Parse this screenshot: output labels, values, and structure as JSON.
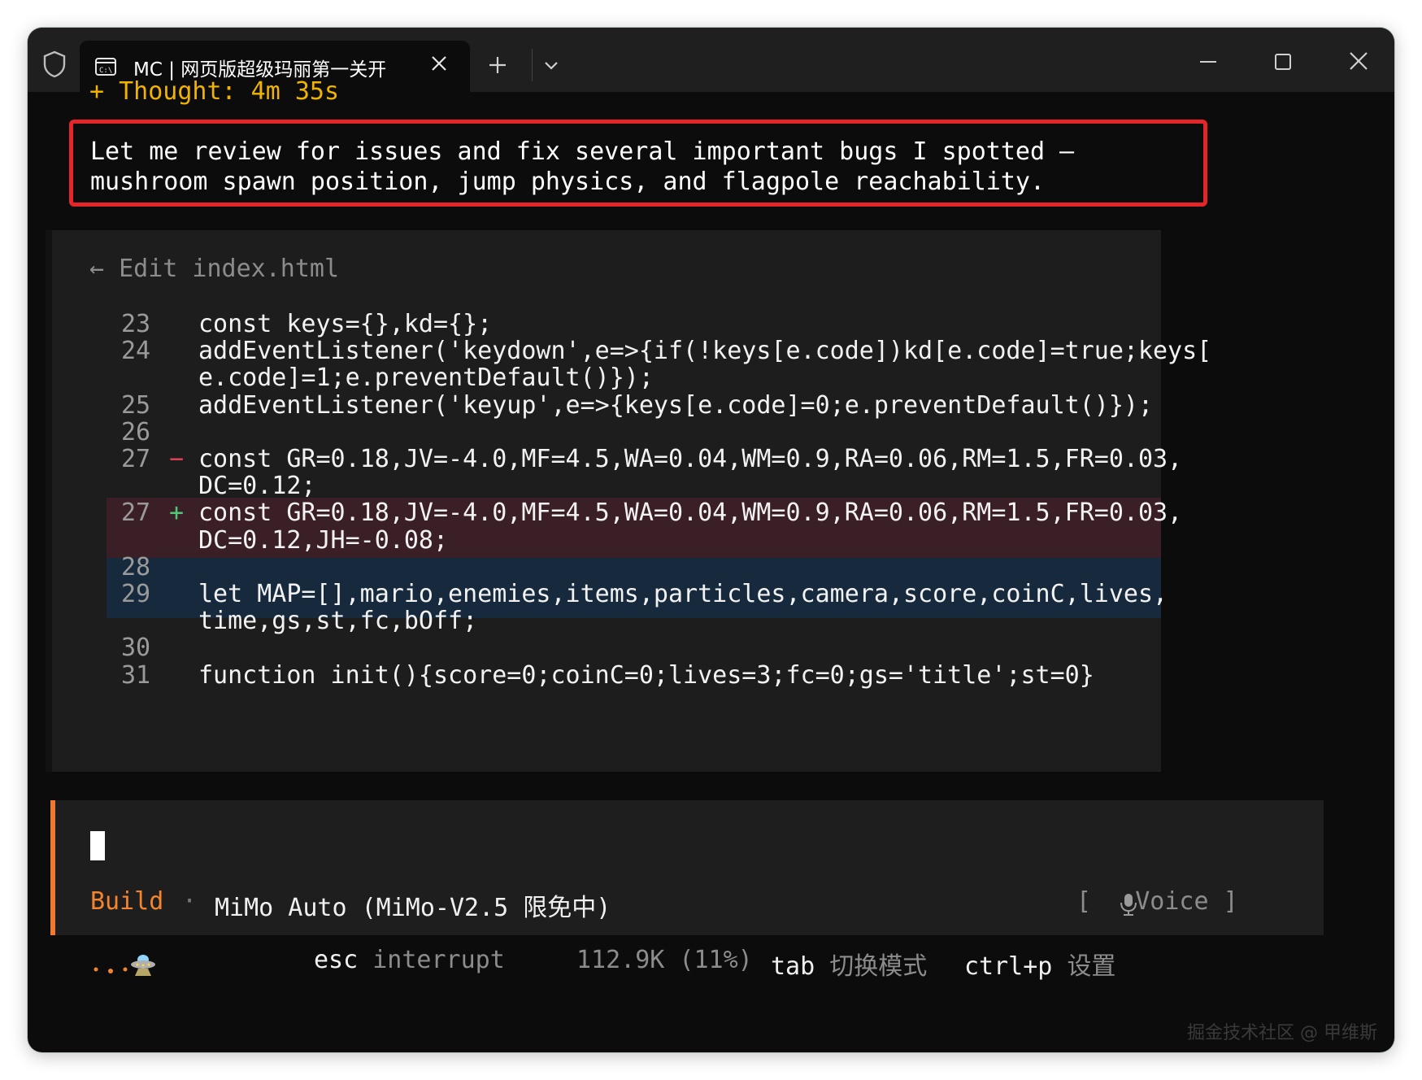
{
  "tab": {
    "title": "MC | 网页版超级玛丽第一关开"
  },
  "thought": "+ Thought: 4m 35s",
  "message": {
    "line1": "Let me review for issues and fix several important bugs I spotted –",
    "line2": "mushroom spawn position, jump physics, and flagpole reachability."
  },
  "edit": {
    "header": "← Edit index.html",
    "lines": [
      {
        "num": "23",
        "sign": "",
        "text": "const keys={},kd={};"
      },
      {
        "num": "24",
        "sign": "",
        "text": "addEventListener('keydown',e=>{if(!keys[e.code])kd[e.code]=true;keys["
      },
      {
        "num": "",
        "sign": "",
        "text": "e.code]=1;e.preventDefault()});"
      },
      {
        "num": "25",
        "sign": "",
        "text": "addEventListener('keyup',e=>{keys[e.code]=0;e.preventDefault()});"
      },
      {
        "num": "26",
        "sign": "",
        "text": ""
      },
      {
        "num": "27",
        "sign": "−",
        "text": "const GR=0.18,JV=-4.0,MF=4.5,WA=0.04,WM=0.9,RA=0.06,RM=1.5,FR=0.03,"
      },
      {
        "num": "",
        "sign": "",
        "text": "DC=0.12;"
      },
      {
        "num": "27",
        "sign": "+",
        "text": "const GR=0.18,JV=-4.0,MF=4.5,WA=0.04,WM=0.9,RA=0.06,RM=1.5,FR=0.03,"
      },
      {
        "num": "",
        "sign": "",
        "text": "DC=0.12,JH=-0.08;"
      },
      {
        "num": "28",
        "sign": "",
        "text": ""
      },
      {
        "num": "29",
        "sign": "",
        "text": "let MAP=[],mario,enemies,items,particles,camera,score,coinC,lives,"
      },
      {
        "num": "",
        "sign": "",
        "text": "time,gs,st,fc,bOff;"
      },
      {
        "num": "30",
        "sign": "",
        "text": ""
      },
      {
        "num": "31",
        "sign": "",
        "text": "function init(){score=0;coinC=0;lives=3;fc=0;gs='title';st=0}"
      }
    ]
  },
  "input": {
    "mode": "Build",
    "separator": "·",
    "model": "MiMo Auto (MiMo-V2.5 限免中)",
    "voice_open": "[",
    "voice_label": "Voice ]"
  },
  "status": {
    "esc_key": "esc",
    "esc_label": "interrupt",
    "tokens": "112.9K (11%)",
    "tab_key": "tab",
    "tab_label": "切换模式",
    "ctrl_key": "ctrl+p",
    "ctrl_label": "设置"
  },
  "watermark": "掘金技术社区 @ 甲维斯",
  "colors": {
    "thought": "#f0b400",
    "highlight_border": "#e5252a",
    "build": "#f4852e",
    "deleted_bg": "#3a1f26",
    "added_bg": "#172a3d",
    "minus_sign": "#e0405a",
    "plus_sign": "#50c878"
  }
}
